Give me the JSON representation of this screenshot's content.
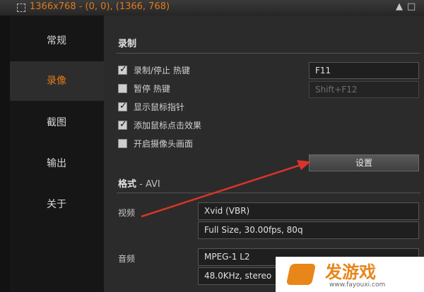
{
  "window": {
    "title": "1366x768 - (0, 0), (1366, 768)"
  },
  "sidebar": {
    "items": [
      {
        "label": "常规"
      },
      {
        "label": "录像"
      },
      {
        "label": "截图"
      },
      {
        "label": "输出"
      },
      {
        "label": "关于"
      }
    ],
    "active": "录像"
  },
  "record": {
    "title": "录制",
    "options": [
      {
        "label": "录制/停止 热键",
        "checked": true
      },
      {
        "label": "暂停 热键",
        "checked": false
      },
      {
        "label": "显示鼠标指针",
        "checked": true
      },
      {
        "label": "添加鼠标点击效果",
        "checked": true
      },
      {
        "label": "开启摄像头画面",
        "checked": false
      }
    ],
    "hotkey_record": "F11",
    "hotkey_pause": "Shift+F12",
    "settings_button": "设置"
  },
  "format": {
    "title": "格式",
    "format_name": " - AVI",
    "video_label": "视频",
    "video_codec": "Xvid (VBR)",
    "video_detail": "Full Size, 30.00fps, 80q",
    "audio_label": "音频",
    "audio_codec": "MPEG-1 L2",
    "audio_detail": "48.0KHz, stereo"
  },
  "watermark": {
    "text": "发游戏",
    "url": "www.fayouxi.com"
  },
  "colors": {
    "accent": "#e07a1c",
    "arrow": "#d9342b"
  }
}
